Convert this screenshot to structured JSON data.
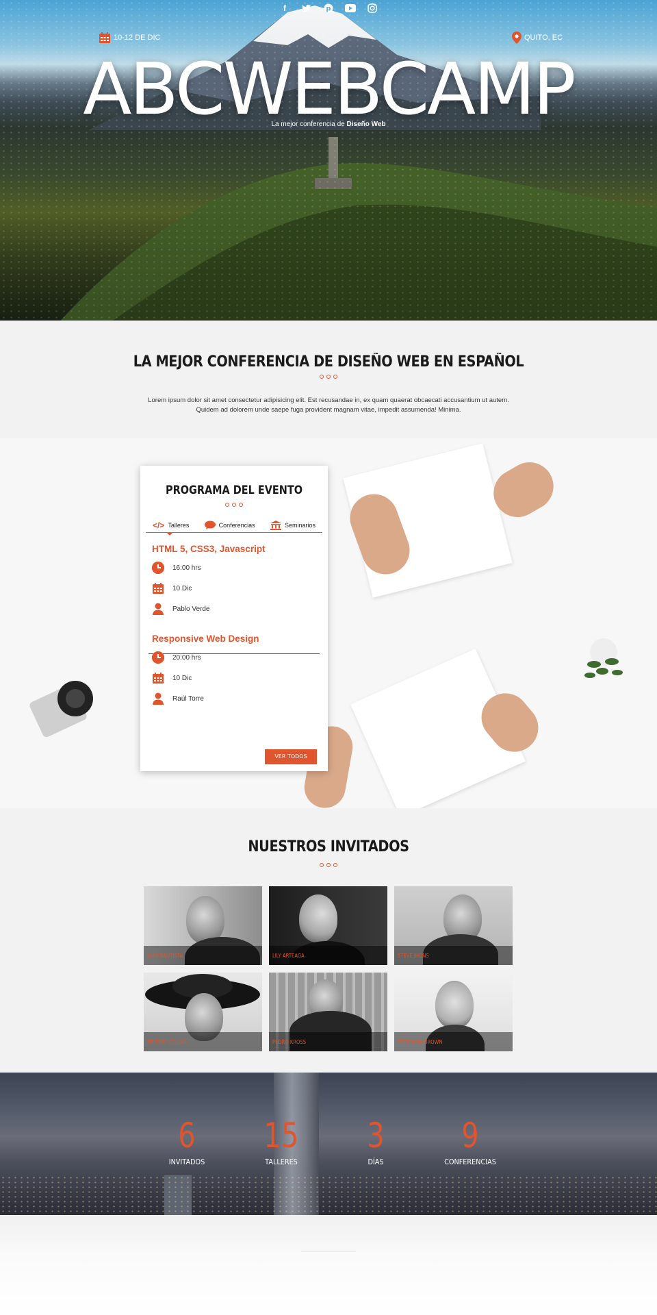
{
  "hero": {
    "social_icons": [
      "facebook-icon",
      "twitter-icon",
      "pinterest-icon",
      "youtube-icon",
      "instagram-icon"
    ],
    "date": "10-12 DE DIC",
    "place": "QUITO, EC",
    "title": "ABCWEBCAMP",
    "subtitle_prefix": "La mejor conferencia de ",
    "subtitle_bold": "Diseño Web"
  },
  "intro": {
    "title": "LA MEJOR CONFERENCIA DE DISEÑO WEB EN ESPAÑOL",
    "text": "Lorem ipsum dolor sit amet consectetur adipisicing elit. Est recusandae in, ex quam quaerat obcaecati accusantium ut autem. Quidem ad dolorem unde saepe fuga provident magnam vitae, impedit assumenda! Minima."
  },
  "programa": {
    "title": "PROGRAMA DEL EVENTO",
    "tabs": [
      {
        "label": "Talleres",
        "icon": "code-icon"
      },
      {
        "label": "Conferencias",
        "icon": "chat-bubble-icon"
      },
      {
        "label": "Seminarios",
        "icon": "university-icon"
      }
    ],
    "events": [
      {
        "title": "HTML 5, CSS3, Javascript",
        "time": "16:00 hrs",
        "date": "10 Dic",
        "speaker": "Pablo Verde"
      },
      {
        "title": "Responsive Web Design",
        "time": "20:00 hrs",
        "date": "10 Dic",
        "speaker": "Raúl Torre"
      }
    ],
    "button": "VER TODOS"
  },
  "invitados": {
    "title": "NUESTROS INVITADOS",
    "guests": [
      {
        "name": "JUAN BAUTISTA"
      },
      {
        "name": "LILY ARTEAGA"
      },
      {
        "name": "STEVE JHONS"
      },
      {
        "name": "BRITANY COLLAR"
      },
      {
        "name": "PEDRO KROSS"
      },
      {
        "name": "ESTEFANIA BROWN"
      }
    ]
  },
  "stats": [
    {
      "value": "6",
      "label": "INVITADOS"
    },
    {
      "value": "15",
      "label": "TALLERES"
    },
    {
      "value": "3",
      "label": "DÍAS"
    },
    {
      "value": "9",
      "label": "CONFERENCIAS"
    }
  ],
  "colors": {
    "accent": "#e0542e",
    "page_bg": "#f2f2f2"
  }
}
